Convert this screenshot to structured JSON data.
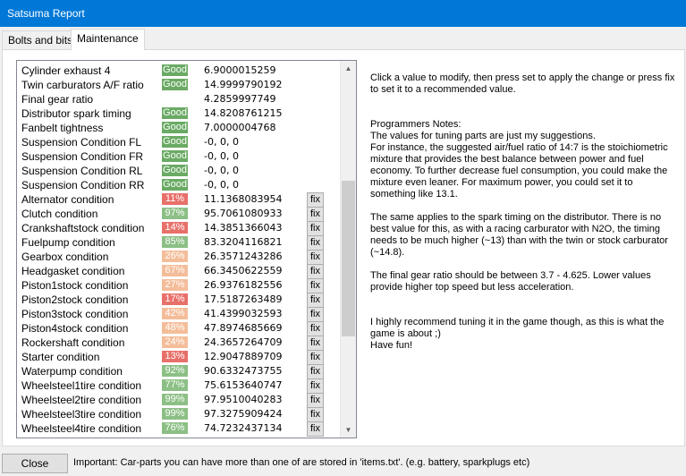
{
  "window": {
    "title": "Satsuma Report"
  },
  "tabs": [
    {
      "label": "Bolts and bits"
    },
    {
      "label": "Maintenance"
    }
  ],
  "colors": {
    "good": "#6aaa64",
    "bad": "#e8706a",
    "fair": "#f4bd9a",
    "partial_good": "#8cbf85"
  },
  "parts": [
    {
      "name": "Cylinder exhaust 4",
      "status": "Good",
      "value": "6.9000015259",
      "fix": ""
    },
    {
      "name": "Twin carburators A/F ratio",
      "status": "Good",
      "value": "14.9999790192",
      "fix": ""
    },
    {
      "name": "Final gear ratio",
      "status": "",
      "value": "4.2859997749",
      "fix": ""
    },
    {
      "name": "Distributor spark timing",
      "status": "Good",
      "value": "14.8208761215",
      "fix": ""
    },
    {
      "name": "Fanbelt tightness",
      "status": "Good",
      "value": "7.0000004768",
      "fix": ""
    },
    {
      "name": "Suspension Condition FL",
      "status": "Good",
      "value": "-0, 0, 0",
      "fix": ""
    },
    {
      "name": "Suspension Condition FR",
      "status": "Good",
      "value": "-0, 0, 0",
      "fix": ""
    },
    {
      "name": "Suspension Condition RL",
      "status": "Good",
      "value": "-0, 0, 0",
      "fix": ""
    },
    {
      "name": "Suspension Condition RR",
      "status": "Good",
      "value": "-0, 0, 0",
      "fix": ""
    },
    {
      "name": "Alternator condition",
      "status": "11%",
      "value": "11.1368083954",
      "fix": "fix"
    },
    {
      "name": "Clutch condition",
      "status": "97%",
      "value": "95.7061080933",
      "fix": "fix"
    },
    {
      "name": "Crankshaftstock condition",
      "status": "14%",
      "value": "14.3851366043",
      "fix": "fix"
    },
    {
      "name": "Fuelpump condition",
      "status": "85%",
      "value": "83.3204116821",
      "fix": "fix"
    },
    {
      "name": "Gearbox condition",
      "status": "26%",
      "value": "26.3571243286",
      "fix": "fix"
    },
    {
      "name": "Headgasket condition",
      "status": "67%",
      "value": "66.3450622559",
      "fix": "fix"
    },
    {
      "name": "Piston1stock condition",
      "status": "27%",
      "value": "26.9376182556",
      "fix": "fix"
    },
    {
      "name": "Piston2stock condition",
      "status": "17%",
      "value": "17.5187263489",
      "fix": "fix"
    },
    {
      "name": "Piston3stock condition",
      "status": "42%",
      "value": "41.4399032593",
      "fix": "fix"
    },
    {
      "name": "Piston4stock condition",
      "status": "48%",
      "value": "47.8974685669",
      "fix": "fix"
    },
    {
      "name": "Rockershaft condition",
      "status": "24%",
      "value": "24.3657264709",
      "fix": "fix"
    },
    {
      "name": "Starter condition",
      "status": "13%",
      "value": "12.9047889709",
      "fix": "fix"
    },
    {
      "name": "Waterpump condition",
      "status": "92%",
      "value": "90.6332473755",
      "fix": "fix"
    },
    {
      "name": "Wheelsteel1tire condition",
      "status": "77%",
      "value": "75.6153640747",
      "fix": "fix"
    },
    {
      "name": "Wheelsteel2tire condition",
      "status": "99%",
      "value": "97.9510040283",
      "fix": "fix"
    },
    {
      "name": "Wheelsteel3tire condition",
      "status": "99%",
      "value": "97.3275909424",
      "fix": "fix"
    },
    {
      "name": "Wheelsteel4tire condition",
      "status": "76%",
      "value": "74.7232437134",
      "fix": "fix"
    }
  ],
  "scrollbar": {
    "position_fraction": 0.55,
    "visible_fraction": 0.45
  },
  "info": {
    "instructions": "Click a value to modify, then press set to apply the change or press fix to set it to a recommended value.",
    "notes_heading": "Programmers Notes:",
    "notes_1": "The values for tuning parts are just my suggestions.\nFor instance, the suggested air/fuel ratio of 14:7 is the stoichiometric mixture that provides the best balance between power and fuel economy. To further decrease fuel consumption, you could make the mixture even leaner. For maximum power, you could set it to something like 13.1.",
    "notes_2": "The same applies to the spark timing on the distributor. There is no best value for this, as with a racing carburator with N2O, the timing needs to be much higher (~13) than with the twin or stock carburator (~14.8).",
    "notes_3": "The final gear ratio should be between 3.7 - 4.625. Lower values provide higher top speed but less acceleration.",
    "notes_4": "I highly recommend tuning it in the game though, as this is what the game is about ;)\nHave fun!"
  },
  "footer": {
    "close_label": "Close",
    "note": "Important: Car-parts you can have more than one of are stored in 'items.txt'. (e.g. battery, sparkplugs etc)"
  }
}
